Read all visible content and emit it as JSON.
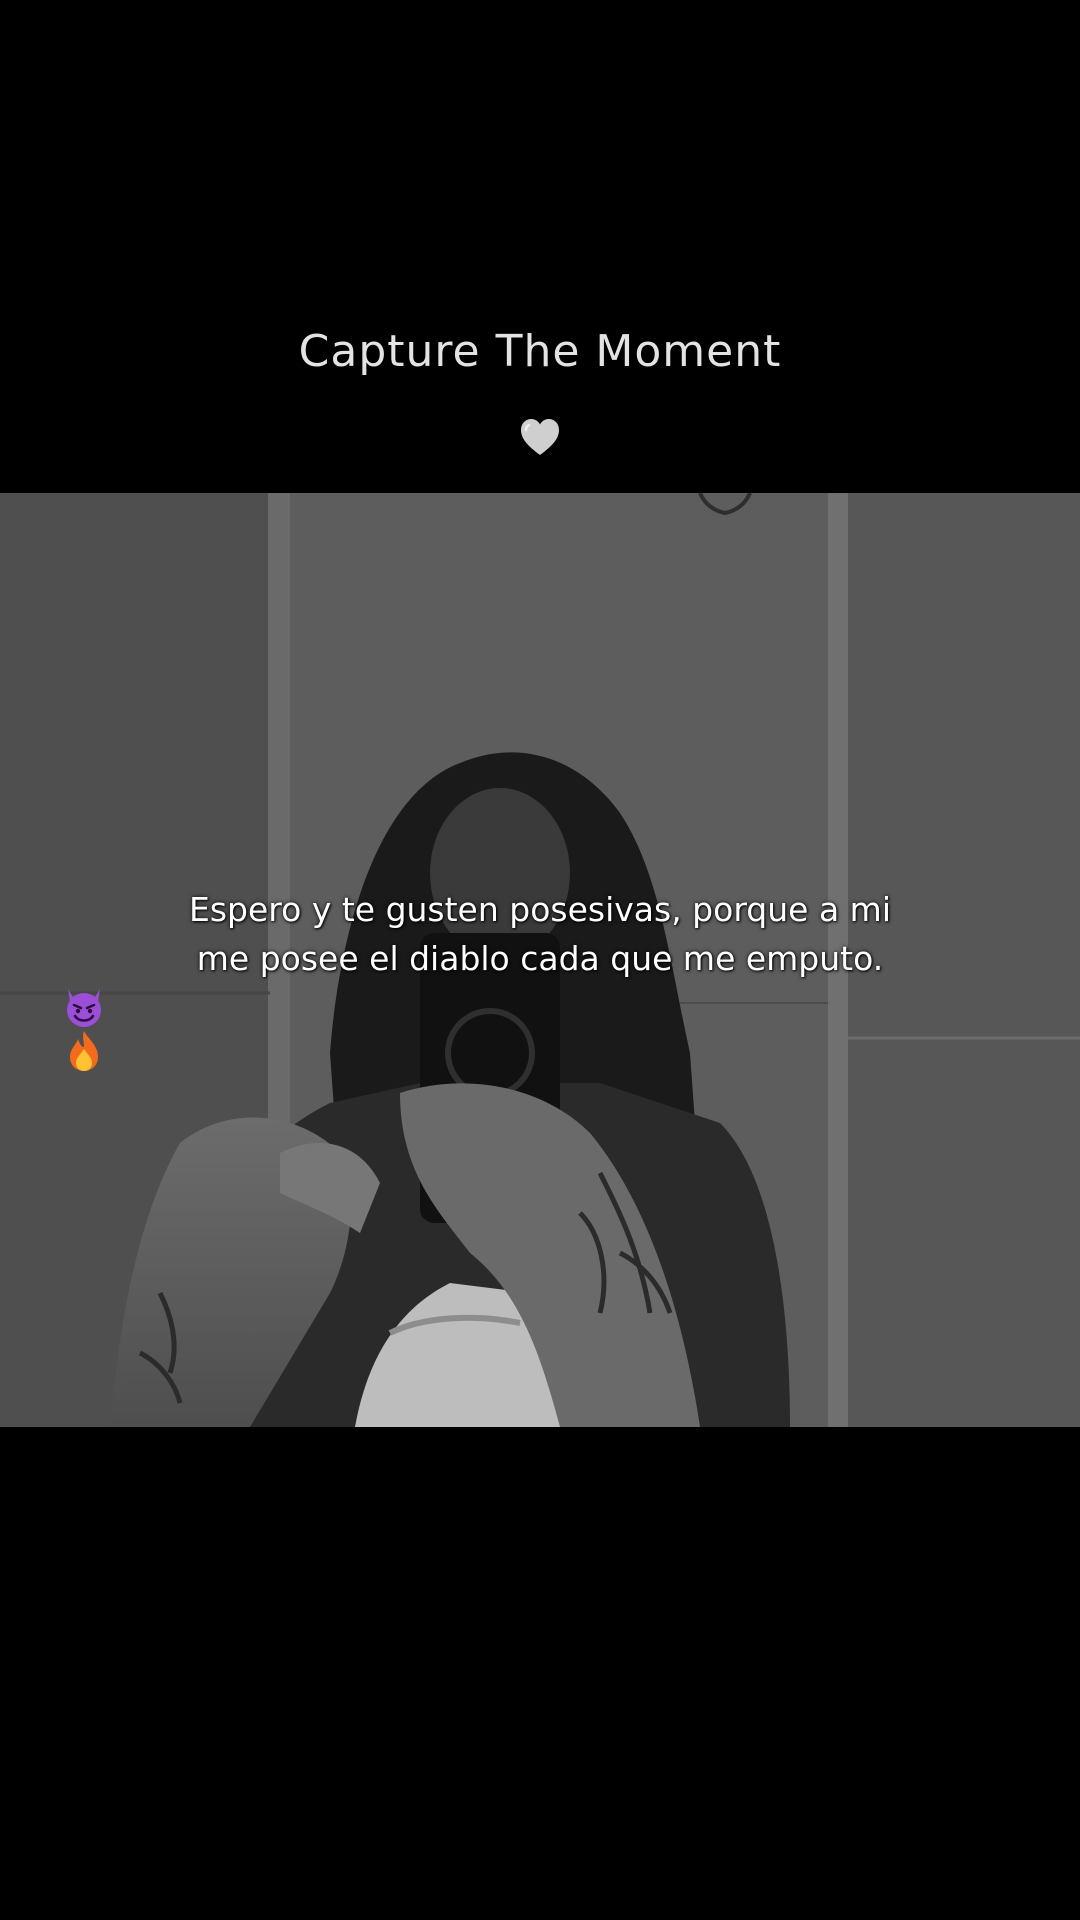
{
  "header": {
    "title": "Capture The Moment",
    "title_icon": "grey-heart-icon"
  },
  "photo": {
    "caption_lines": [
      "Espero y te gusten posesivas, porque a mi",
      "me posee el diablo cada que me emputo."
    ],
    "caption_emojis": [
      "smiling-devil-icon",
      "fire-icon"
    ]
  },
  "colors": {
    "background": "#000000",
    "title_text": "#e3e3e3",
    "caption_text": "#ffffff",
    "heart": "#c8c8c8",
    "devil": "#9b4fd6",
    "fire": "#f56b1d"
  }
}
